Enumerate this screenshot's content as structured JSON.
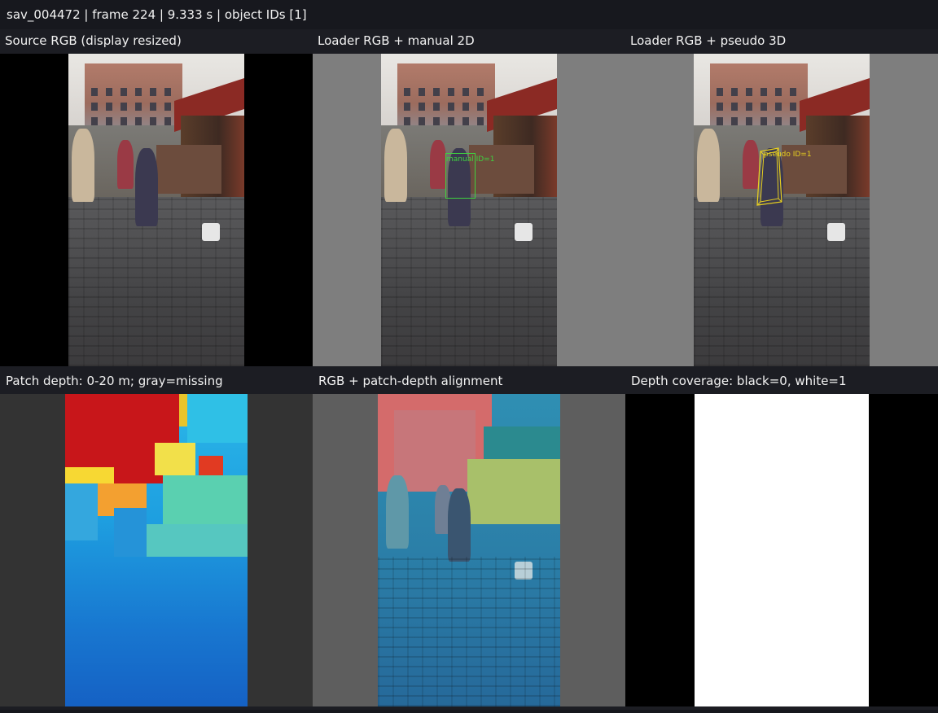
{
  "header": {
    "text": "sav_004472 | frame 224 | 9.333 s | object IDs [1]"
  },
  "panels": [
    {
      "title": "Source RGB (display resized)"
    },
    {
      "title": "Loader RGB + manual 2D"
    },
    {
      "title": "Loader RGB + pseudo 3D"
    },
    {
      "title": "Patch depth: 0-20 m; gray=missing"
    },
    {
      "title": "RGB + patch-depth alignment"
    },
    {
      "title": "Depth coverage: black=0, white=1"
    }
  ],
  "annotations": {
    "manual_label": "manual ID=1",
    "pseudo_label": "pseudo ID=1"
  },
  "colors": {
    "manual_box": "#3fd23f",
    "pseudo_box": "#e8d020",
    "missing_gray": "#333333"
  }
}
